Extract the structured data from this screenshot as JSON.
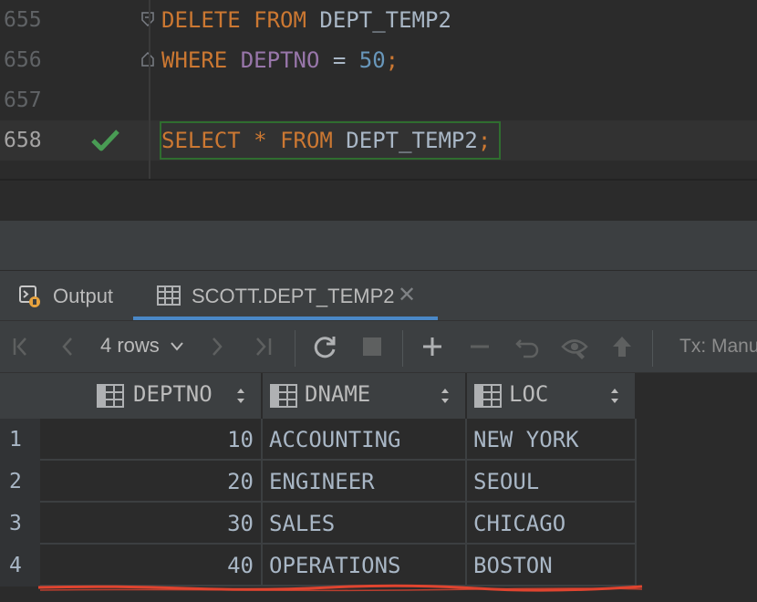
{
  "editor": {
    "lines": [
      {
        "number": "655",
        "tokens": [
          {
            "t": "DELETE",
            "c": "kw"
          },
          {
            "t": " "
          },
          {
            "t": "FROM",
            "c": "kw"
          },
          {
            "t": " DEPT_TEMP2"
          }
        ]
      },
      {
        "number": "656",
        "tokens": [
          {
            "t": "WHERE",
            "c": "kw"
          },
          {
            "t": " "
          },
          {
            "t": "DEPTNO",
            "c": "col"
          },
          {
            "t": " = "
          },
          {
            "t": "50",
            "c": "num"
          },
          {
            "t": ";",
            "c": "semi"
          }
        ]
      },
      {
        "number": "657",
        "tokens": []
      },
      {
        "number": "658",
        "tokens": [
          {
            "t": "SELECT",
            "c": "kw"
          },
          {
            "t": " "
          },
          {
            "t": "*",
            "c": "kw"
          },
          {
            "t": " "
          },
          {
            "t": "FROM",
            "c": "kw"
          },
          {
            "t": " DEPT_TEMP2"
          },
          {
            "t": ";",
            "c": "semi"
          }
        ]
      }
    ],
    "current_line": "658",
    "execution_status_icon": "checkmark-icon"
  },
  "tabs": {
    "output_label": "Output",
    "result_label": "SCOTT.DEPT_TEMP2",
    "active": "SCOTT.DEPT_TEMP2"
  },
  "toolbar": {
    "rows_label": "4 rows",
    "tx_label": "Tx: Manu",
    "icons": [
      "first-page-icon",
      "previous-page-icon",
      "rows-dropdown-icon",
      "next-page-icon",
      "last-page-icon",
      "reload-icon",
      "stop-icon",
      "add-row-icon",
      "delete-row-icon",
      "revert-icon",
      "view-query-icon",
      "submit-icon"
    ]
  },
  "grid": {
    "columns": [
      "DEPTNO",
      "DNAME",
      "LOC"
    ],
    "rows": [
      {
        "no": "1",
        "deptno": "10",
        "dname": "ACCOUNTING",
        "loc": "NEW YORK"
      },
      {
        "no": "2",
        "deptno": "20",
        "dname": "ENGINEER",
        "loc": "SEOUL"
      },
      {
        "no": "3",
        "deptno": "30",
        "dname": "SALES",
        "loc": "CHICAGO"
      },
      {
        "no": "4",
        "deptno": "40",
        "dname": "OPERATIONS",
        "loc": "BOSTON"
      }
    ]
  },
  "colors": {
    "keyword": "#cc7832",
    "column": "#9876aa",
    "number": "#6897bb",
    "identifier": "#a9b7c6",
    "success": "#499c54",
    "annotation_underline": "#e0442f",
    "tab_accent": "#4a88c7"
  }
}
